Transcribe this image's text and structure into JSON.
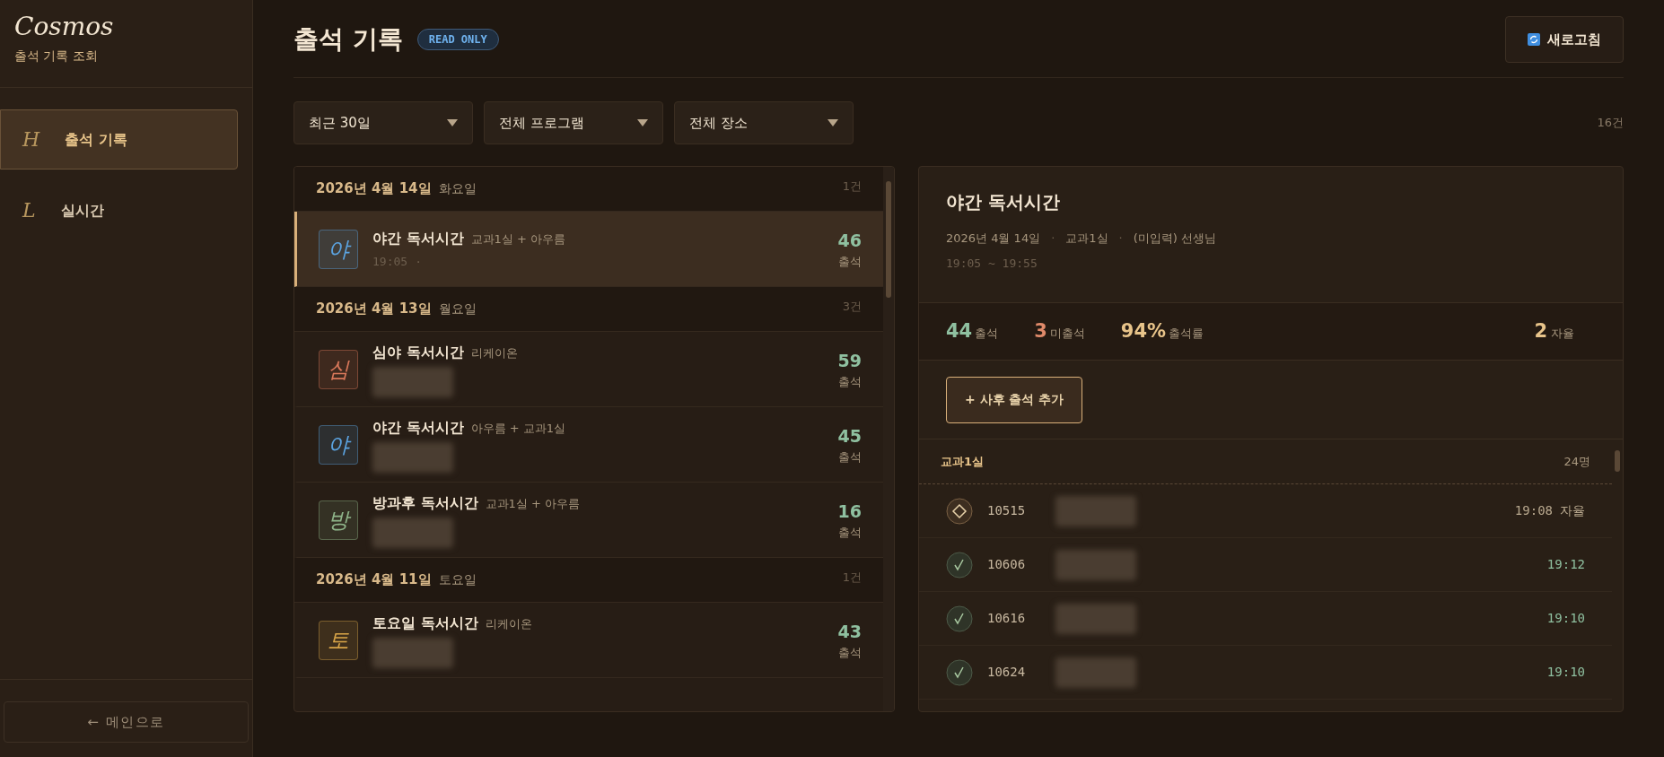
{
  "sidebar": {
    "logo": "Cosmos",
    "subtitle": "출석 기록 조회",
    "items": [
      {
        "glyph": "H",
        "label": "출석 기록",
        "selected": true
      },
      {
        "glyph": "L",
        "label": "실시간",
        "selected": false
      }
    ],
    "back_button": "← 메인으로"
  },
  "header": {
    "title": "출석 기록",
    "badge": "READ ONLY",
    "refresh_button": "새로고침"
  },
  "filters": [
    "최근 30일",
    "전체 프로그램",
    "전체 장소"
  ],
  "total_count": "16건",
  "list": [
    {
      "kind": "date",
      "date": "2026년 4월 14일",
      "weekday": "화요일",
      "count": "1건"
    },
    {
      "kind": "session",
      "glyph": "야",
      "color": "#5ba3e0",
      "title": "야간 독서시간",
      "rooms": "교과1실 + 아우름",
      "time": "19:05",
      "separator": "·",
      "teacher_hidden": false,
      "count": "46",
      "count_label": "출석",
      "selected": true
    },
    {
      "kind": "date",
      "date": "2026년 4월 13일",
      "weekday": "월요일",
      "count": "3건"
    },
    {
      "kind": "session",
      "glyph": "심",
      "color": "#d9785a",
      "title": "심야 독서시간",
      "rooms": "리케이온",
      "teacher_hidden": true,
      "count": "59",
      "count_label": "출석",
      "selected": false
    },
    {
      "kind": "session",
      "glyph": "야",
      "color": "#5ba3e0",
      "title": "야간 독서시간",
      "rooms": "아우름 + 교과1실",
      "teacher_hidden": true,
      "count": "45",
      "count_label": "출석",
      "selected": false
    },
    {
      "kind": "session",
      "glyph": "방",
      "color": "#8fb58a",
      "title": "방과후 독서시간",
      "rooms": "교과1실 + 아우름",
      "teacher_hidden": true,
      "count": "16",
      "count_label": "출석",
      "selected": false
    },
    {
      "kind": "date",
      "date": "2026년 4월 11일",
      "weekday": "토요일",
      "count": "1건"
    },
    {
      "kind": "session",
      "glyph": "토",
      "color": "#d8a548",
      "title": "토요일 독서시간",
      "rooms": "리케이온",
      "teacher_hidden": true,
      "count": "43",
      "count_label": "출석",
      "selected": false
    }
  ],
  "detail": {
    "title": "야간 독서시간",
    "meta": [
      "2026년 4월 14일",
      "교과1실",
      "(미입력) 선생님"
    ],
    "meta_separator": "·",
    "time_range": "19:05 ~ 19:55",
    "stats": [
      {
        "value": "44",
        "label": "출석",
        "color": "#8fc0a0"
      },
      {
        "value": "3",
        "label": "미출석",
        "color": "#e08a6a"
      },
      {
        "value": "94%",
        "label": "출석률",
        "color": "#e8c48a"
      }
    ],
    "self_study": {
      "value": "2",
      "label": "자율"
    },
    "add_button": "+ 사후 출석 추가",
    "group": {
      "name": "교과1실",
      "count": "24명"
    },
    "students": [
      {
        "kind": "self",
        "id": "10515",
        "time": "19:08",
        "tag": "자율"
      },
      {
        "kind": "present",
        "id": "10606",
        "time": "19:12"
      },
      {
        "kind": "present",
        "id": "10616",
        "time": "19:10"
      },
      {
        "kind": "present",
        "id": "10624",
        "time": "19:10"
      }
    ]
  }
}
